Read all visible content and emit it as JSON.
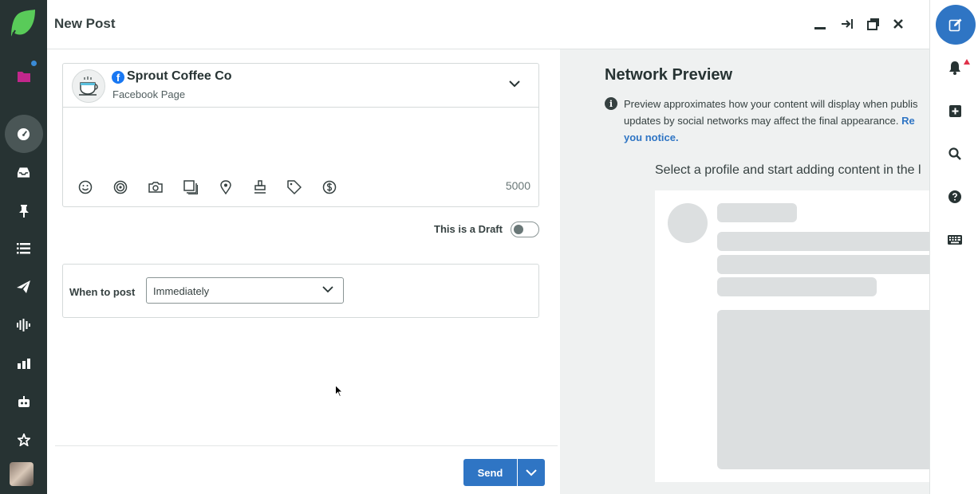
{
  "header": {
    "title": "New Post",
    "buttons": [
      "minimize-icon",
      "collapse-right-icon",
      "popout-icon",
      "close-icon"
    ]
  },
  "left_nav": {
    "items": [
      "folder-icon",
      "dashboard-icon",
      "inbox-icon",
      "pin-icon",
      "list-icon",
      "send-icon",
      "listening-icon",
      "reports-icon",
      "bot-icon",
      "star-icon"
    ],
    "active": "dashboard-icon"
  },
  "composer": {
    "profile": {
      "name": "Sprout Coffee Co",
      "type": "Facebook Page",
      "network_icon": "facebook-icon"
    },
    "toolbar": [
      "emoji-icon",
      "target-icon",
      "camera-icon",
      "gallery-icon",
      "location-icon",
      "stamp-icon",
      "tag-icon",
      "dollar-icon"
    ],
    "char_count": "5000",
    "draft": {
      "label": "This is a Draft",
      "enabled": false
    },
    "when": {
      "label": "When to post",
      "selected": "Immediately"
    },
    "send_label": "Send"
  },
  "preview": {
    "title": "Network Preview",
    "info_line1": "Preview approximates how your content will display when publis",
    "info_line2_text": "updates by social networks may affect the final appearance. ",
    "info_line2_link": "Re",
    "info_line3_link": "you notice.",
    "prompt": "Select a profile and start adding content in the l"
  },
  "right_rail": {
    "items": [
      "compose-icon",
      "bell-icon",
      "plus-square-icon",
      "search-icon",
      "help-icon",
      "keyboard-icon"
    ]
  },
  "colors": {
    "nav_bg": "#273333",
    "accent": "#2f75c4",
    "preview_bg": "#eff1f1",
    "logo_green": "#59cb59",
    "notif_red": "#e0324a"
  }
}
